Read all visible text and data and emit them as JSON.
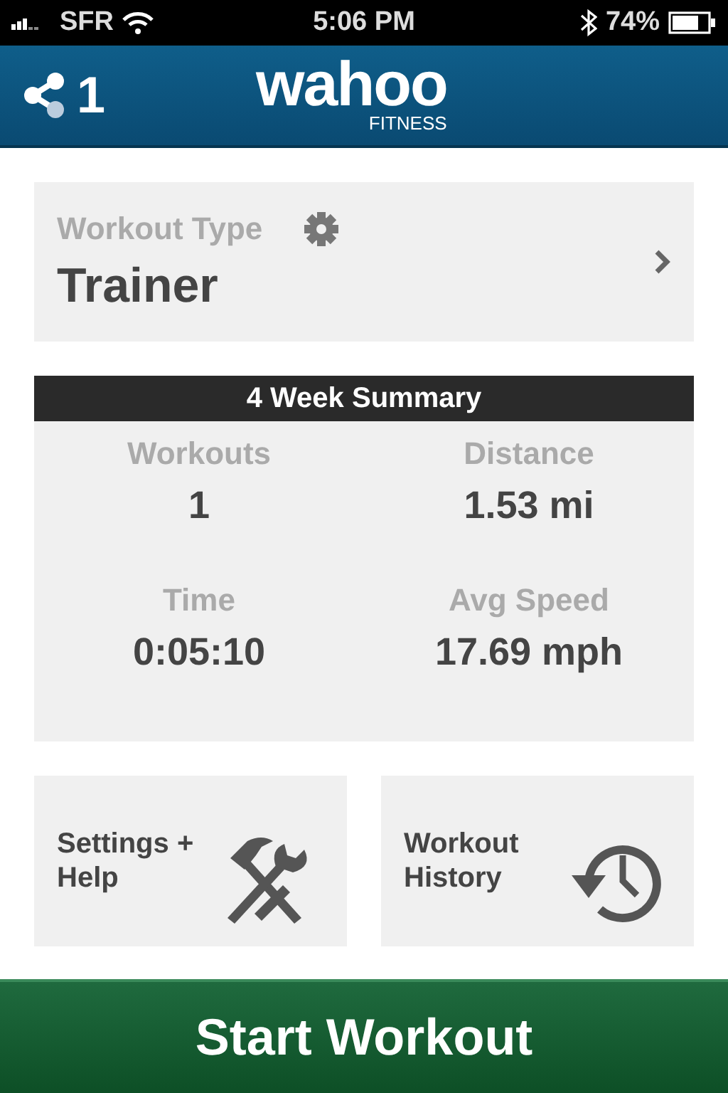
{
  "status_bar": {
    "carrier": "SFR",
    "time": "5:06 PM",
    "battery": "74%"
  },
  "header": {
    "share_count": "1",
    "logo": "wahoo",
    "logo_sub": "FITNESS"
  },
  "workout_type": {
    "label": "Workout Type",
    "value": "Trainer"
  },
  "summary": {
    "title": "4 Week Summary",
    "stats": [
      {
        "label": "Workouts",
        "value": "1"
      },
      {
        "label": "Distance",
        "value": "1.53 mi"
      },
      {
        "label": "Time",
        "value": "0:05:10"
      },
      {
        "label": "Avg Speed",
        "value": "17.69 mph"
      }
    ]
  },
  "tiles": [
    {
      "kind": "settings",
      "label": "Settings + Help"
    },
    {
      "kind": "history",
      "label": "Workout History"
    }
  ],
  "start_button": "Start Workout"
}
